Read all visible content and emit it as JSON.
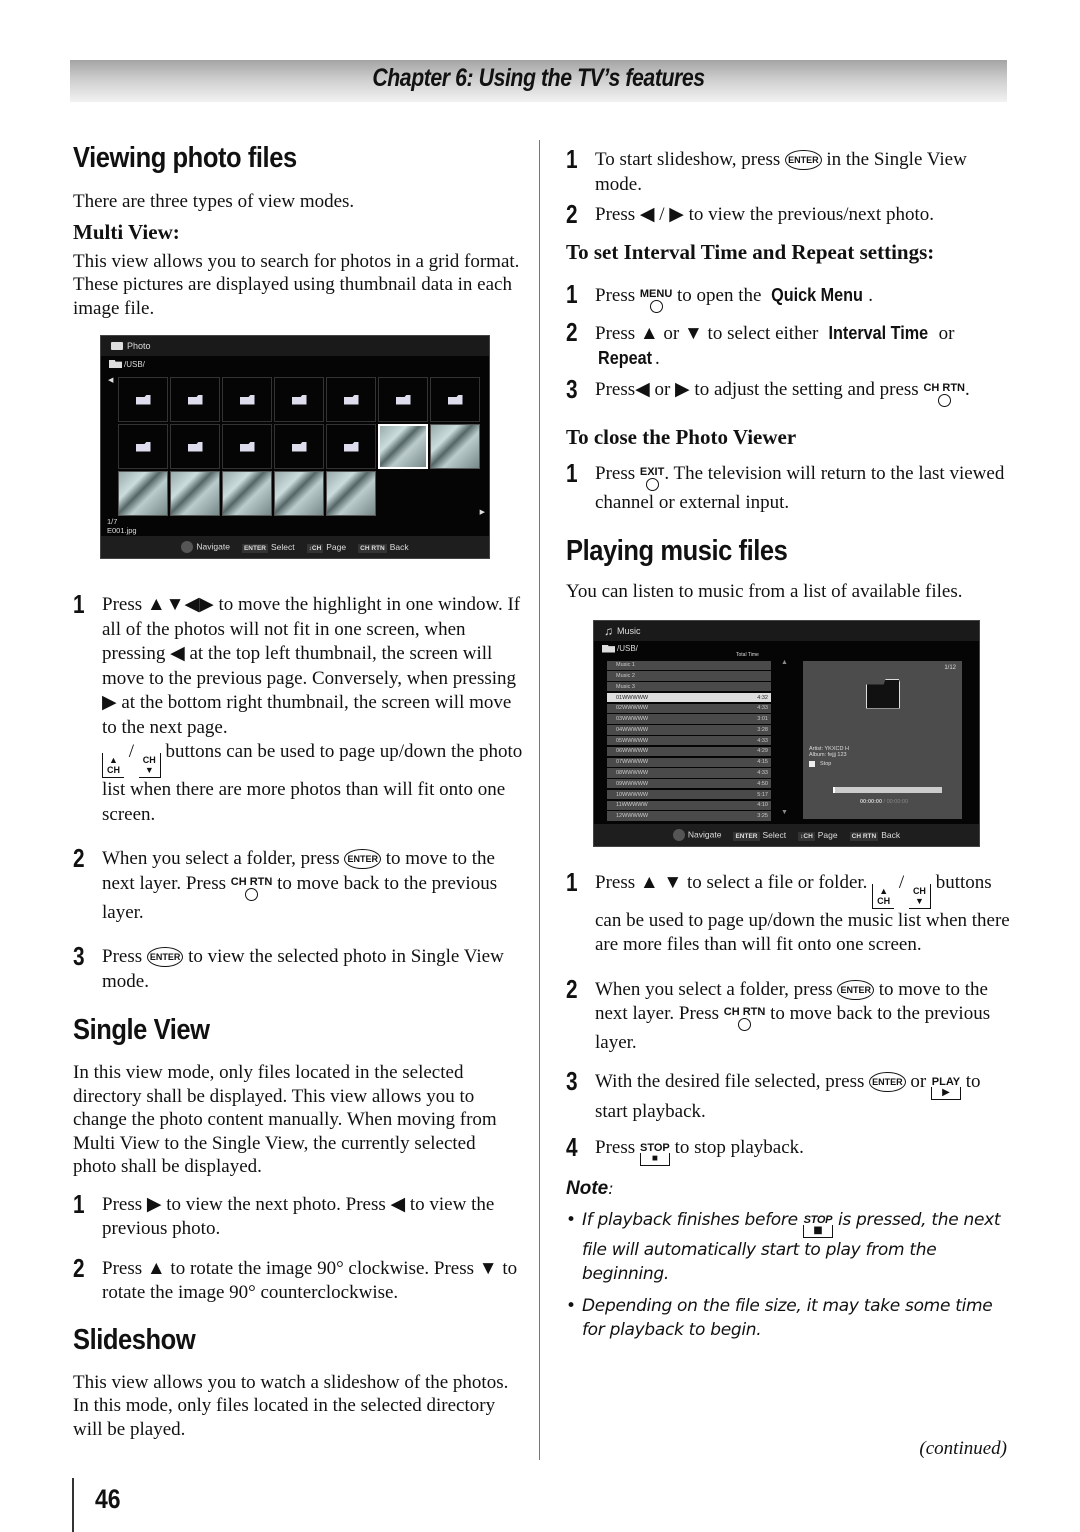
{
  "chapter_title": "Chapter 6: Using the TV’s features",
  "left": {
    "viewing_title": "Viewing photo files",
    "intro": "There are three types of view modes.",
    "multi_view_title": "Multi View:",
    "multi_view_text": "This view allows you to search for photos in a grid format. These pictures are displayed using thumbnail data in each image file.",
    "photo_screen": {
      "header": "Photo",
      "path": "/USB/",
      "count": "1/7",
      "filename": "E001.jpg",
      "footer": [
        {
          "key": "",
          "label": "Navigate"
        },
        {
          "key": "ENTER",
          "label": "Select"
        },
        {
          "key": "↕CH",
          "label": "Page"
        },
        {
          "key": "CH RTN",
          "label": "Back"
        }
      ]
    },
    "steps": [
      {
        "num": "1",
        "text_a": "Press ▲▼◀▶ to move the highlight in one window. If all of the photos will not fit in one screen, when pressing ◀ at the top left thumbnail, the screen will move to the previous page. Conversely, when pressing ▶ at the bottom right thumbnail, the screen will move to the next page.",
        "text_b": "buttons can be used to page up/down the photo list when there are more photos than will fit onto one screen."
      },
      {
        "num": "2",
        "text_a": "When you select a folder, press",
        "text_b": "to move to the next layer. Press",
        "text_c": "to move back to the previous layer."
      },
      {
        "num": "3",
        "text_a": "Press",
        "text_b": "to view the selected photo in Single View mode."
      }
    ],
    "single_view_title": "Single View",
    "single_view_text": "In this view mode, only files located in the selected directory shall be displayed. This view allows you to change the photo content manually. When moving from Multi View to the Single View, the currently selected photo shall be displayed.",
    "single_steps": [
      {
        "num": "1",
        "text": "Press ▶ to view the next photo. Press ◀ to view the previous photo."
      },
      {
        "num": "2",
        "text": "Press ▲ to rotate the image 90° clockwise. Press ▼ to rotate the image 90° counterclockwise."
      }
    ],
    "slideshow_title": "Slideshow",
    "slideshow_text": "This view allows you to watch a slideshow of the photos. In this mode, only files located in the selected directory will be played."
  },
  "right": {
    "slide_steps": [
      {
        "num": "1",
        "text_a": "To start slideshow, press",
        "text_b": "in the Single View mode."
      },
      {
        "num": "2",
        "text": "Press ◀ / ▶ to view the previous/next photo."
      }
    ],
    "interval_title": "To set Interval Time and Repeat settings:",
    "interval_steps": [
      {
        "num": "1",
        "text_a": "Press",
        "text_b": "to open the",
        "bold": "Quick Menu",
        "text_c": "."
      },
      {
        "num": "2",
        "text_a": "Press ▲ or ▼ to select either",
        "bold1": "Interval Time",
        "text_b": "or",
        "bold2": "Repeat",
        "text_c": "."
      },
      {
        "num": "3",
        "text_a": "Press◀ or ▶ to adjust the setting and press",
        "text_b": "."
      }
    ],
    "close_title": "To close the Photo Viewer",
    "close_step": {
      "num": "1",
      "text_a": "Press",
      "text_b": ". The television will return to the last viewed channel or external input."
    },
    "music_title": "Playing music files",
    "music_intro": "You can listen to music from a list of available files.",
    "music_screen": {
      "header": "Music",
      "path": "/USB/",
      "total_time_label": "Total Time",
      "rows": [
        {
          "name": "Music 1",
          "time": "",
          "selected": false
        },
        {
          "name": "Music 2",
          "time": "",
          "selected": false
        },
        {
          "name": "Music 3",
          "time": "",
          "selected": false
        },
        {
          "name": "01WWWWW",
          "time": "4:32",
          "selected": true
        },
        {
          "name": "02WWWWW",
          "time": "4:33",
          "selected": false
        },
        {
          "name": "03WWWWW",
          "time": "3:01",
          "selected": false
        },
        {
          "name": "04WWWWW",
          "time": "3:28",
          "selected": false
        },
        {
          "name": "05WWWWW",
          "time": "4:33",
          "selected": false
        },
        {
          "name": "06WWWWW",
          "time": "4:29",
          "selected": false
        },
        {
          "name": "07WWWWW",
          "time": "4:15",
          "selected": false
        },
        {
          "name": "08WWWWW",
          "time": "4:33",
          "selected": false
        },
        {
          "name": "09WWWWW",
          "time": "4:50",
          "selected": false
        },
        {
          "name": "10WWWWW",
          "time": "5:17",
          "selected": false
        },
        {
          "name": "11WWWWW",
          "time": "4:10",
          "selected": false
        },
        {
          "name": "12WWWWW",
          "time": "3:25",
          "selected": false
        }
      ],
      "count": "1/12",
      "artist": "Artist:  YKXCD H",
      "album": "Album:  fejjj 123",
      "status": "Stop",
      "progress": 0,
      "time_elapsed": "00:00:00",
      "time_total": " / 00:00:00",
      "footer": [
        {
          "key": "",
          "label": "Navigate"
        },
        {
          "key": "ENTER",
          "label": "Select"
        },
        {
          "key": "↕CH",
          "label": "Page"
        },
        {
          "key": "CH RTN",
          "label": "Back"
        }
      ]
    },
    "music_steps": [
      {
        "num": "1",
        "text_a": "Press ▲ ▼ to select a file or folder.",
        "text_b": "buttons can be used to page up/down the music list when there are more files than will fit onto one screen."
      },
      {
        "num": "2",
        "text_a": "When you select a folder, press",
        "text_b": "to move to the next layer. Press",
        "text_c": "to move back to the previous layer."
      },
      {
        "num": "3",
        "text_a": "With the desired file selected, press",
        "text_b": "or",
        "text_c": "to start playback."
      },
      {
        "num": "4",
        "text_a": "Press",
        "text_b": "to stop playback."
      }
    ],
    "note_title": "Note",
    "notes": [
      {
        "text_a": "If playback finishes before",
        "text_b": "is pressed, the next file will automatically start to play from the beginning."
      },
      {
        "text": "Depending on the file size, it may take some time for playback to begin."
      }
    ]
  },
  "buttons": {
    "enter": "ENTER",
    "ch_rtn": "CH RTN",
    "menu": "MENU",
    "exit": "EXIT",
    "play": "PLAY",
    "stop": "STOP",
    "ch": "CH",
    "up": "▲",
    "down": "▼",
    "play_glyph": "▶",
    "stop_glyph": "■"
  },
  "continued": "(continued)",
  "page_number": "46"
}
